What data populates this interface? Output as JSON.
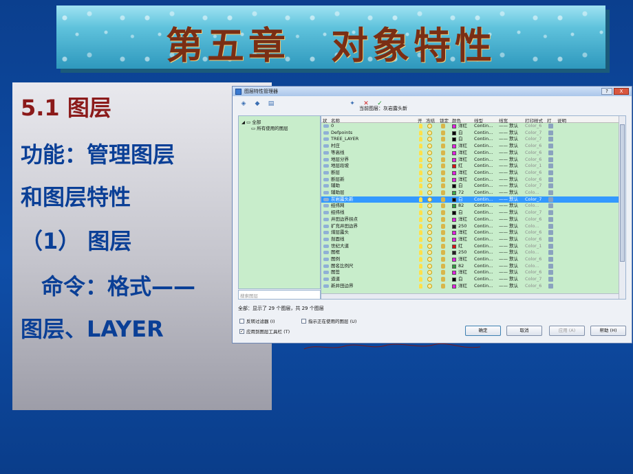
{
  "slide": {
    "title": "第五章　对象特性",
    "left": {
      "line1": "5.1 图层",
      "line2": "功能：管理图层",
      "line3": "和图层特性",
      "line4": "（1） 图层",
      "line5": "命令：格式——",
      "line6": "图层、LAYER"
    }
  },
  "dialog": {
    "title": "图层特性管理器",
    "window_buttons": {
      "help": "?",
      "close": "X"
    },
    "toolbar_icons": [
      "new-property-filter-icon",
      "new-group-filter-icon",
      "layer-states-icon",
      "new-layer-icon",
      "delete-layer-icon",
      "set-current-icon"
    ],
    "current_layer_label": "当前图层：灰岩露头新",
    "tree": {
      "root": "全部",
      "child": "所有使用的图层"
    },
    "search_placeholder": "搜索图层",
    "columns": [
      "状",
      "名称",
      "开",
      "冻结",
      "锁定",
      "颜色",
      "线型",
      "线宽",
      "打印样式",
      "打",
      "说明"
    ],
    "rows": [
      {
        "name": "0",
        "color_name": "洋红",
        "color": "#e020e0",
        "linetype": "Contin...",
        "lineweight": "—— 默认",
        "plot_style": "Color_6"
      },
      {
        "name": "Defpoints",
        "color_name": "白",
        "color": "#000000",
        "linetype": "Contin...",
        "lineweight": "—— 默认",
        "plot_style": "Color_7"
      },
      {
        "name": "TREE_LAYER",
        "color_name": "白",
        "color": "#000000",
        "linetype": "Contin...",
        "lineweight": "—— 默认",
        "plot_style": "Color_7"
      },
      {
        "name": "村庄",
        "color_name": "洋红",
        "color": "#e020e0",
        "linetype": "Contin...",
        "lineweight": "—— 默认",
        "plot_style": "Color_6"
      },
      {
        "name": "等高线",
        "color_name": "洋红",
        "color": "#e020e0",
        "linetype": "Contin...",
        "lineweight": "—— 默认",
        "plot_style": "Color_6"
      },
      {
        "name": "地层分界",
        "color_name": "洋红",
        "color": "#e020e0",
        "linetype": "Contin...",
        "lineweight": "—— 默认",
        "plot_style": "Color_6"
      },
      {
        "name": "地层段坡",
        "color_name": "红",
        "color": "#d81010",
        "linetype": "Contin...",
        "lineweight": "—— 默认",
        "plot_style": "Color_1"
      },
      {
        "name": "断层",
        "color_name": "洋红",
        "color": "#e020e0",
        "linetype": "Contin...",
        "lineweight": "—— 默认",
        "plot_style": "Color_6"
      },
      {
        "name": "断层新",
        "color_name": "洋红",
        "color": "#e020e0",
        "linetype": "Contin...",
        "lineweight": "—— 默认",
        "plot_style": "Color_6"
      },
      {
        "name": "辅助",
        "color_name": "白",
        "color": "#000000",
        "linetype": "Contin...",
        "lineweight": "—— 默认",
        "plot_style": "Color_7"
      },
      {
        "name": "辅助层",
        "color_name": "72",
        "color": "#3aa84a",
        "linetype": "Contin...",
        "lineweight": "—— 默认",
        "plot_style": "Colo..."
      },
      {
        "name": "灰岩露头新",
        "color_name": "白",
        "color": "#000000",
        "linetype": "Contin...",
        "lineweight": "—— 默认",
        "plot_style": "Color_7",
        "selected": true
      },
      {
        "name": "经纬网",
        "color_name": "82",
        "color": "#2e9a3c",
        "linetype": "Contin...",
        "lineweight": "—— 默认",
        "plot_style": "Colo..."
      },
      {
        "name": "经纬线",
        "color_name": "白",
        "color": "#000000",
        "linetype": "Contin...",
        "lineweight": "—— 默认",
        "plot_style": "Color_7"
      },
      {
        "name": "井田边界拐点",
        "color_name": "洋红",
        "color": "#e020e0",
        "linetype": "Contin...",
        "lineweight": "—— 默认",
        "plot_style": "Color_6"
      },
      {
        "name": "扩充井田边界",
        "color_name": "250",
        "color": "#222222",
        "linetype": "Contin...",
        "lineweight": "—— 默认",
        "plot_style": "Colo..."
      },
      {
        "name": "煤层露头",
        "color_name": "洋红",
        "color": "#e020e0",
        "linetype": "Contin...",
        "lineweight": "—— 默认",
        "plot_style": "Color_6"
      },
      {
        "name": "剖面线",
        "color_name": "洋红",
        "color": "#e020e0",
        "linetype": "Contin...",
        "lineweight": "—— 默认",
        "plot_style": "Color_6"
      },
      {
        "name": "世纪大道",
        "color_name": "红",
        "color": "#d81010",
        "linetype": "Contin...",
        "lineweight": "—— 默认",
        "plot_style": "Color_1"
      },
      {
        "name": "图框",
        "color_name": "250",
        "color": "#222222",
        "linetype": "Contin...",
        "lineweight": "—— 默认",
        "plot_style": "Colo..."
      },
      {
        "name": "图例",
        "color_name": "洋红",
        "color": "#e020e0",
        "linetype": "Contin...",
        "lineweight": "—— 默认",
        "plot_style": "Color_6"
      },
      {
        "name": "图名比例尺",
        "color_name": "82",
        "color": "#2e9a3c",
        "linetype": "Contin...",
        "lineweight": "—— 默认",
        "plot_style": "Colo..."
      },
      {
        "name": "图签",
        "color_name": "洋红",
        "color": "#e020e0",
        "linetype": "Contin...",
        "lineweight": "—— 默认",
        "plot_style": "Color_6"
      },
      {
        "name": "道道",
        "color_name": "白",
        "color": "#000000",
        "linetype": "Contin...",
        "lineweight": "—— 默认",
        "plot_style": "Color_7"
      },
      {
        "name": "新井田边界",
        "color_name": "洋红",
        "color": "#e020e0",
        "linetype": "Contin...",
        "lineweight": "—— 默认",
        "plot_style": "Color_6"
      }
    ],
    "status": "全部：显示了 29 个图层，共 29 个图层",
    "invert_filter": "反转过滤器 (I)",
    "indicate_used": "指示正在使用的图层 (U)",
    "apply_toolbar": "应用到图层工具栏 (T)",
    "buttons": {
      "ok": "确定",
      "cancel": "取消",
      "apply": "应用 (A)",
      "help": "帮助 (H)"
    }
  }
}
